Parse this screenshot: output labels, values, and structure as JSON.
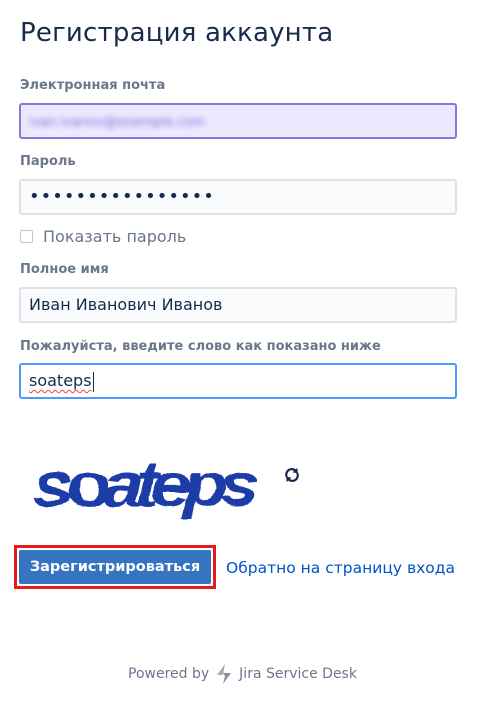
{
  "page": {
    "title": "Регистрация аккаунта"
  },
  "form": {
    "email": {
      "label": "Электронная почта",
      "value": "ivan.ivanov@example.com",
      "blurred": true
    },
    "password": {
      "label": "Пароль",
      "value": "••••••••••••••••"
    },
    "show_password": {
      "label": "Показать пароль",
      "checked": false
    },
    "full_name": {
      "label": "Полное имя",
      "value": "Иван Иванович Иванов"
    },
    "captcha": {
      "label": "Пожалуйста, введите слово как показано ниже",
      "value": "soateps",
      "image_text": "soateps",
      "refresh_icon": "refresh-icon"
    }
  },
  "actions": {
    "submit_label": "Зарегистрироваться",
    "back_link_label": "Обратно на страницу входа"
  },
  "footer": {
    "powered_by": "Powered by",
    "product": "Jira Service Desk",
    "icon": "jira-service-desk-logo-icon"
  },
  "colors": {
    "primary": "#3674c0",
    "link": "#0052cc",
    "highlight_border": "#e51b1b",
    "captcha_text": "#1e3da8"
  }
}
